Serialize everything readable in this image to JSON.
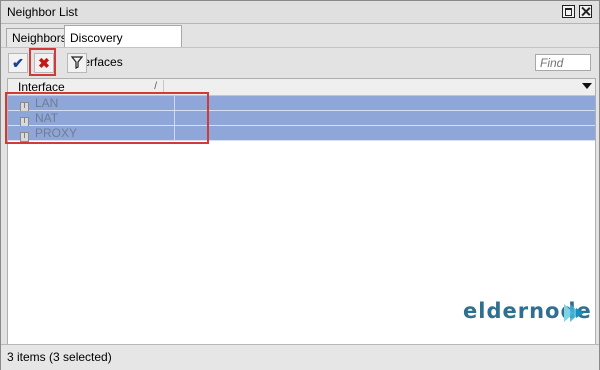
{
  "window": {
    "title": "Neighbor List",
    "tabs": [
      {
        "label": "Neighbors",
        "active": false
      },
      {
        "label": "Discovery Interfaces",
        "active": true
      }
    ]
  },
  "toolbar": {
    "enable_icon": "✔",
    "disable_icon": "✖",
    "filter_icon": "funnel-icon",
    "find_placeholder": "Find"
  },
  "table": {
    "columns": [
      {
        "label": "Interface",
        "sort_mark": "/"
      }
    ],
    "rows": [
      {
        "interface": "LAN",
        "selected": true
      },
      {
        "interface": "NAT",
        "selected": true
      },
      {
        "interface": "PROXY",
        "selected": true
      }
    ],
    "row_icon": "I"
  },
  "watermark": {
    "part1": "elder",
    "part2": "node"
  },
  "status": {
    "text": "3 items (3 selected)"
  },
  "colors": {
    "selection": "#8fa7d8",
    "highlight_box": "#d23a3a"
  }
}
